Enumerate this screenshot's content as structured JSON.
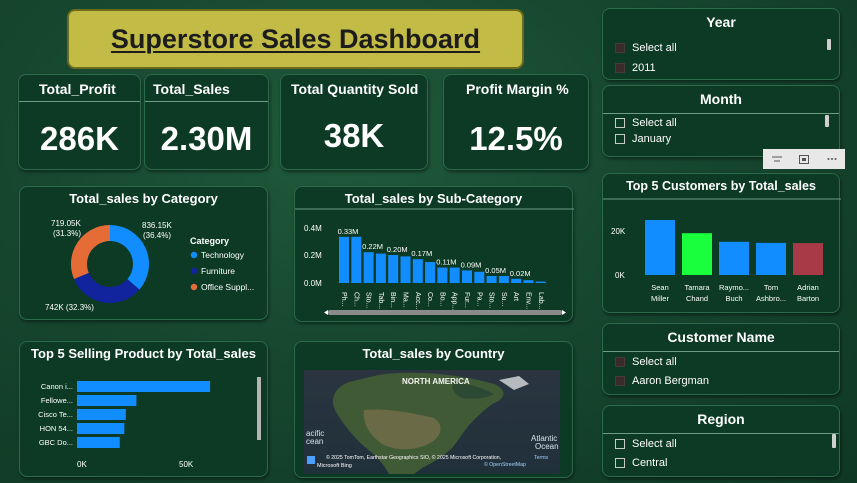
{
  "header": {
    "title": "Superstore Sales Dashboard"
  },
  "kpis": {
    "profit": {
      "label": "Total_Profit",
      "value": "286K"
    },
    "sales": {
      "label": "Total_Sales",
      "value": "2.30M"
    },
    "qty": {
      "label": "Total Quantity Sold",
      "value": "38K"
    },
    "margin": {
      "label": "Profit Margin %",
      "value": "12.5%"
    }
  },
  "category_chart": {
    "title": "Total_sales by Category",
    "legend_title": "Category",
    "legend": [
      "Technology",
      "Furniture",
      "Office Suppl..."
    ],
    "labels": {
      "office": [
        "719.05K",
        "(31.3%)"
      ],
      "tech": [
        "836.15K",
        "(36.4%)"
      ],
      "furniture": "742K (32.3%)"
    }
  },
  "subcat_chart": {
    "title": "Total_sales by Sub-Category",
    "y_ticks": [
      "0.4M",
      "0.2M",
      "0.0M"
    ],
    "bar_labels": [
      "0.33M",
      "0.22M",
      "0.20M",
      "0.17M",
      "0.11M",
      "0.09M",
      "0.05M",
      "0.02M"
    ],
    "x_labels": [
      "Ph...",
      "Ch...",
      "Sto...",
      "Tab...",
      "Bin...",
      "Ma...",
      "Acc...",
      "Co...",
      "Bo...",
      "App...",
      "Fur...",
      "Pa...",
      "Sto...",
      "Su...",
      "Art",
      "Env...",
      "Lab..."
    ]
  },
  "customers_chart": {
    "title": "Top 5 Customers by Total_sales",
    "y_ticks": [
      "20K",
      "0K"
    ],
    "names": [
      [
        "Sean",
        "Miller"
      ],
      [
        "Tamara",
        "Chand"
      ],
      [
        "Raymo...",
        "Buch"
      ],
      [
        "Tom",
        "Ashbro..."
      ],
      [
        "Adrian",
        "Barton"
      ]
    ]
  },
  "products_chart": {
    "title": "Top 5 Selling Product by Total_sales",
    "names": [
      "Canon i...",
      "Fellowe...",
      "Cisco Te...",
      "HON 54...",
      "GBC Do..."
    ],
    "x_ticks": [
      "0K",
      "50K"
    ]
  },
  "map": {
    "title": "Total_sales by Country",
    "labels": {
      "north_america": "NORTH AMERICA",
      "pacific": [
        "acific",
        "cean"
      ],
      "atlantic": [
        "Atlantic",
        "Ocean"
      ]
    },
    "attribution": "© 2025 TomTom, Earthstar Geographics SIO, © 2025 Microsoft Corporation,",
    "terms": "Terms",
    "osm": "© OpenStreetMap",
    "brand": "Microsoft Bing"
  },
  "slicers": {
    "year": {
      "title": "Year",
      "options": [
        "Select all",
        "2011"
      ]
    },
    "month": {
      "title": "Month",
      "options": [
        "Select all",
        "January"
      ]
    },
    "customer": {
      "title": "Customer Name",
      "options": [
        "Select all",
        "Aaron Bergman"
      ]
    },
    "region": {
      "title": "Region",
      "options": [
        "Select all",
        "Central"
      ]
    }
  },
  "chart_data": [
    {
      "type": "pie",
      "title": "Total_sales by Category",
      "categories": [
        "Technology",
        "Furniture",
        "Office Supplies"
      ],
      "values": [
        836150,
        742000,
        719050
      ],
      "colors": [
        "#118dff",
        "#12239e",
        "#e66c37"
      ]
    },
    {
      "type": "bar",
      "title": "Total_sales by Sub-Category",
      "categories": [
        "Ph...",
        "Ch...",
        "Sto...",
        "Tab...",
        "Bin...",
        "Ma...",
        "Acc...",
        "Co...",
        "Bo...",
        "App...",
        "Fur...",
        "Pa...",
        "Sto...",
        "Su...",
        "Art",
        "Env...",
        "Lab..."
      ],
      "values": [
        0.33,
        0.33,
        0.22,
        0.21,
        0.2,
        0.19,
        0.17,
        0.15,
        0.11,
        0.11,
        0.09,
        0.08,
        0.05,
        0.05,
        0.03,
        0.02,
        0.01
      ],
      "ylabel": "",
      "ylim": [
        0,
        0.4
      ],
      "unit": "M"
    },
    {
      "type": "bar",
      "title": "Top 5 Customers by Total_sales",
      "categories": [
        "Sean Miller",
        "Tamara Chand",
        "Raymond Buch",
        "Tom Ashbrook",
        "Adrian Barton"
      ],
      "values": [
        25000,
        19000,
        15100,
        14600,
        14500
      ],
      "colors": [
        "#118dff",
        "#1aff3c",
        "#118dff",
        "#118dff",
        "#a83a48"
      ],
      "ylim": [
        0,
        30000
      ]
    },
    {
      "type": "bar",
      "orientation": "horizontal",
      "title": "Top 5 Selling Product by Total_sales",
      "categories": [
        "Canon i...",
        "Fellowe...",
        "Cisco Te...",
        "HON 54...",
        "GBC Do..."
      ],
      "values": [
        61600,
        27500,
        22600,
        21900,
        19800
      ],
      "xlim": [
        0,
        80000
      ]
    }
  ]
}
